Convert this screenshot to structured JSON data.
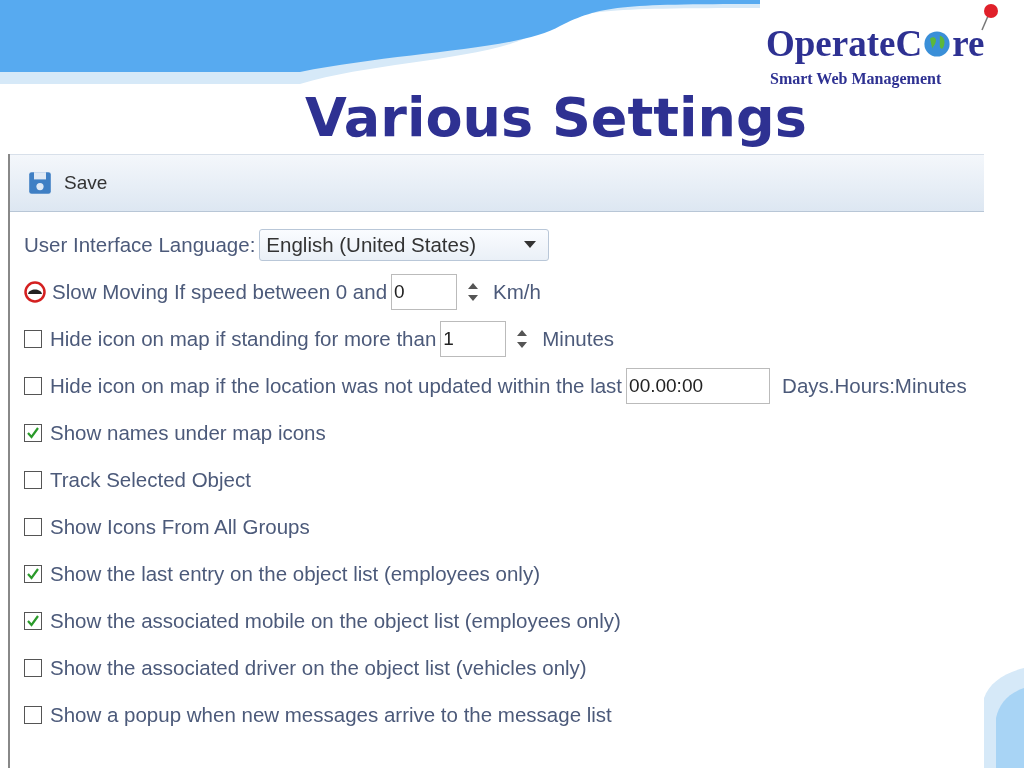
{
  "logo": {
    "name_start": "OperateC",
    "name_end": "re",
    "tagline": "Smart Web Management"
  },
  "title": "Various Settings",
  "toolbar": {
    "save": "Save"
  },
  "settings": [
    {
      "kind": "select",
      "label": "User Interface Language:",
      "value": "English (United States)"
    },
    {
      "kind": "icon",
      "label": "Slow Moving If speed between 0 and",
      "value": "0",
      "spinner": true,
      "unit": "Km/h"
    },
    {
      "kind": "check",
      "checked": false,
      "label": "Hide icon on map if standing for more than",
      "value": "1",
      "spinner": true,
      "unit": "Minutes"
    },
    {
      "kind": "check",
      "checked": false,
      "label": "Hide icon on map if the location was not updated within the last",
      "value": "00.00:00",
      "spinner": false,
      "unit": "Days.Hours:Minutes"
    },
    {
      "kind": "check",
      "checked": true,
      "label": "Show names under map icons"
    },
    {
      "kind": "check",
      "checked": false,
      "label": "Track Selected Object"
    },
    {
      "kind": "check",
      "checked": false,
      "label": "Show Icons From All Groups"
    },
    {
      "kind": "check",
      "checked": true,
      "label": "Show the last entry on the object list (employees only)"
    },
    {
      "kind": "check",
      "checked": true,
      "label": "Show the associated mobile on the object list (employees only)"
    },
    {
      "kind": "check",
      "checked": false,
      "label": "Show the associated driver on the object list (vehicles only)"
    },
    {
      "kind": "check",
      "checked": false,
      "label": "Show a popup when new messages arrive to the message list"
    }
  ]
}
